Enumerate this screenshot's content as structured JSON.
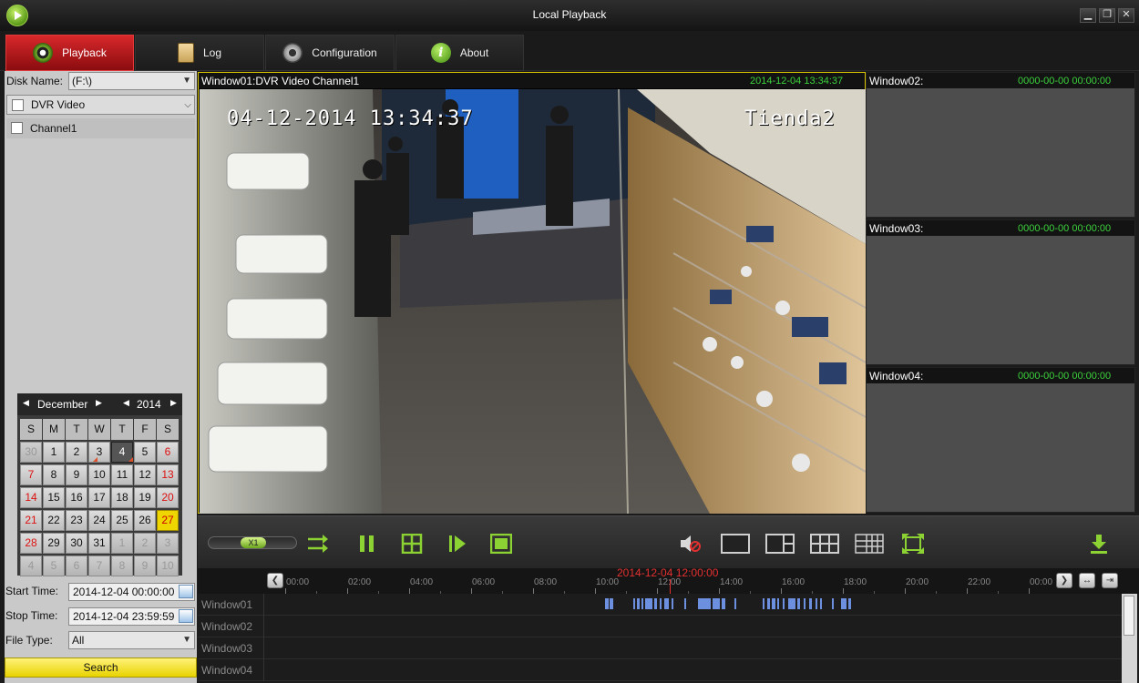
{
  "window": {
    "title": "Local Playback"
  },
  "tabs": [
    {
      "label": "Playback",
      "active": true
    },
    {
      "label": "Log",
      "active": false
    },
    {
      "label": "Configuration",
      "active": false
    },
    {
      "label": "About",
      "active": false
    }
  ],
  "left": {
    "disk_label": "Disk Name:",
    "disk_value": "(F:\\)",
    "type_value": "DVR Video",
    "channel": "Channel1"
  },
  "calendar": {
    "month": "December",
    "year": "2014",
    "dow": [
      "S",
      "M",
      "T",
      "W",
      "T",
      "F",
      "S"
    ],
    "weeks": [
      [
        "30",
        "1",
        "2",
        "3",
        "4",
        "5",
        "6"
      ],
      [
        "7",
        "8",
        "9",
        "10",
        "11",
        "12",
        "13"
      ],
      [
        "14",
        "15",
        "16",
        "17",
        "18",
        "19",
        "20"
      ],
      [
        "21",
        "22",
        "23",
        "24",
        "25",
        "26",
        "27"
      ],
      [
        "28",
        "29",
        "30",
        "31",
        "1",
        "2",
        "3"
      ],
      [
        "4",
        "5",
        "6",
        "7",
        "8",
        "9",
        "10"
      ]
    ],
    "selected_day": "4",
    "today_day": "27"
  },
  "search": {
    "start_label": "Start Time:",
    "start_value": "2014-12-04 00:00:00",
    "stop_label": "Stop Time:",
    "stop_value": "2014-12-04 23:59:59",
    "filetype_label": "File Type:",
    "filetype_value": "All",
    "button": "Search"
  },
  "windows": {
    "main": {
      "title": "Window01:DVR Video Channel1",
      "time": "2014-12-04 13:34:37",
      "osd_time": "04-12-2014 13:34:37",
      "osd_name": "Tienda2"
    },
    "w2": {
      "title": "Window02:",
      "time": "0000-00-00 00:00:00"
    },
    "w3": {
      "title": "Window03:",
      "time": "0000-00-00 00:00:00"
    },
    "w4": {
      "title": "Window04:",
      "time": "0000-00-00 00:00:00"
    }
  },
  "controls": {
    "speed": "X1"
  },
  "timeline": {
    "cursor_time": "2014-12-04 12:00:00",
    "ticks": [
      "00:00",
      "02:00",
      "04:00",
      "06:00",
      "08:00",
      "10:00",
      "12:00",
      "14:00",
      "16:00",
      "18:00",
      "20:00",
      "22:00",
      "00:00"
    ],
    "rows": [
      "Window01",
      "Window02",
      "Window03",
      "Window04"
    ]
  },
  "colors": {
    "accent_red": "#d8282b",
    "osd_green": "#3cd33c",
    "control_green": "#8bd232",
    "highlight_yellow": "#f0d600",
    "record_blue": "#6d8fe0"
  }
}
